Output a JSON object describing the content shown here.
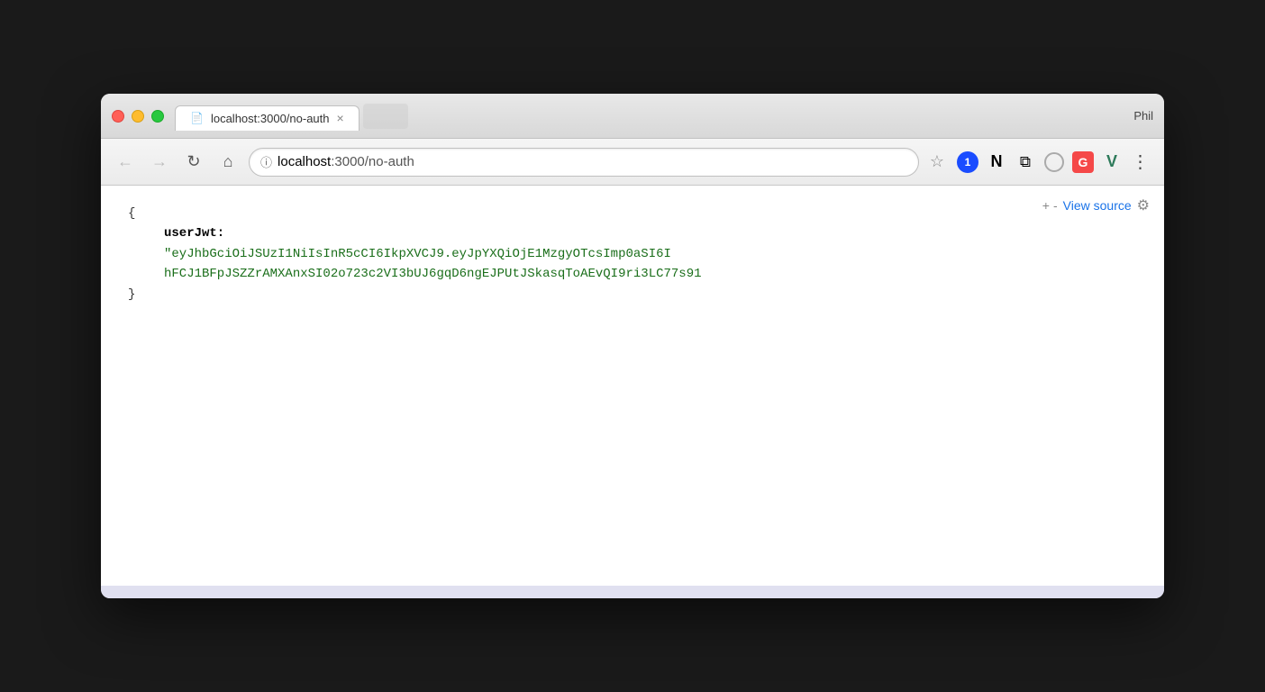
{
  "browser": {
    "profile": "Phil",
    "traffic_lights": {
      "close_label": "close",
      "minimize_label": "minimize",
      "maximize_label": "maximize"
    },
    "tab": {
      "page_icon": "📄",
      "title": "localhost:3000/no-auth",
      "close_label": "×"
    },
    "address_bar": {
      "url_host": "localhost",
      "url_port_path": ":3000/no-auth",
      "full_url": "localhost:3000/no-auth"
    },
    "nav": {
      "back_label": "‹",
      "forward_label": "›",
      "refresh_label": "↻",
      "home_label": "⌂"
    }
  },
  "json_toolbar": {
    "plus_label": "+",
    "minus_label": "-",
    "view_source_label": "View source",
    "settings_icon": "⚙"
  },
  "json_content": {
    "open_brace": "{",
    "key": "userJwt:",
    "value_line1": "\"eyJhbGciOiJSUzI1NiIsInR5cCI6IkpXVCJ9.eyJpYXQiOjE1MzgyOTcsImp0aSI6I",
    "value_line2": "hFCJ1BFpJSZZrAMXAnxSI02o723c2VI3bUJ6gqD6ngEJPUtJSkasqToAEvQI9ri3LC77s91",
    "close_brace": "}"
  }
}
